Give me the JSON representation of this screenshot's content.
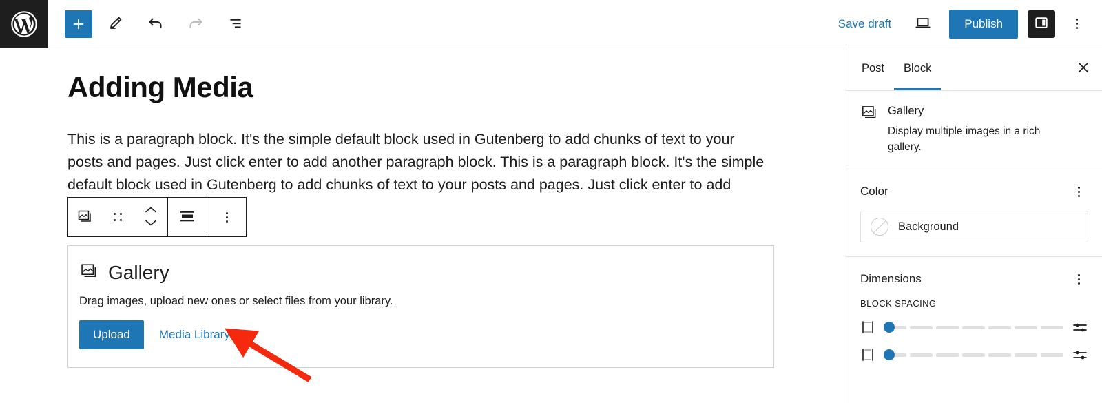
{
  "topbar": {
    "logo_icon": "wordpress-logo",
    "add_block_label": "+",
    "add_block_icon": "plus-icon",
    "edit_icon": "pencil-icon",
    "undo_icon": "undo-arrow-icon",
    "redo_icon": "redo-arrow-icon",
    "list_view_icon": "list-view-icon",
    "save_draft_label": "Save draft",
    "preview_icon": "laptop-preview-icon",
    "publish_label": "Publish",
    "settings_toggle_icon": "sidebar-panel-icon",
    "more_menu_icon": "vertical-ellipsis-icon",
    "accent_color": "#1e76b5",
    "dark_color": "#1e1e1e"
  },
  "editor": {
    "title": "Adding Media",
    "paragraph": "This is a paragraph block. It's the simple default block used in Gutenberg to add chunks of text to your posts and pages. Just click enter to add another paragraph block. This is a paragraph block. It's the simple default block used in Gutenberg to add chunks of text to your posts and pages. Just click enter to add another paragraph",
    "block_toolbar": {
      "block_type_icon": "gallery-icon",
      "drag_handle_icon": "drag-handle-icon",
      "move_up_icon": "chevron-up-icon",
      "move_down_icon": "chevron-down-icon",
      "align_icon": "align-center-icon",
      "more_options_icon": "vertical-ellipsis-icon"
    },
    "gallery_block": {
      "icon": "gallery-icon",
      "title": "Gallery",
      "description": "Drag images, upload new ones or select files from your library.",
      "upload_label": "Upload",
      "media_library_label": "Media Library"
    },
    "annotation": {
      "type": "arrow",
      "color": "#f4290d",
      "points_at": "Media Library"
    }
  },
  "sidebar": {
    "tabs": [
      {
        "label": "Post",
        "active": false
      },
      {
        "label": "Block",
        "active": true
      }
    ],
    "close_icon": "close-icon",
    "block": {
      "icon": "gallery-icon",
      "name": "Gallery",
      "description": "Display multiple images in a rich gallery."
    },
    "color_section": {
      "title": "Color",
      "menu_icon": "vertical-ellipsis-icon",
      "background_label": "Background",
      "background_swatch": "none"
    },
    "dimensions_section": {
      "title": "Dimensions",
      "menu_icon": "vertical-ellipsis-icon",
      "block_spacing_label": "BLOCK SPACING",
      "sliders": [
        {
          "icon": "vertical-spacing-icon",
          "value": 0,
          "segments": 7,
          "settings_icon": "slider-settings-icon"
        },
        {
          "icon": "horizontal-spacing-icon",
          "value": 0,
          "segments": 7,
          "settings_icon": "slider-settings-icon"
        }
      ]
    }
  }
}
